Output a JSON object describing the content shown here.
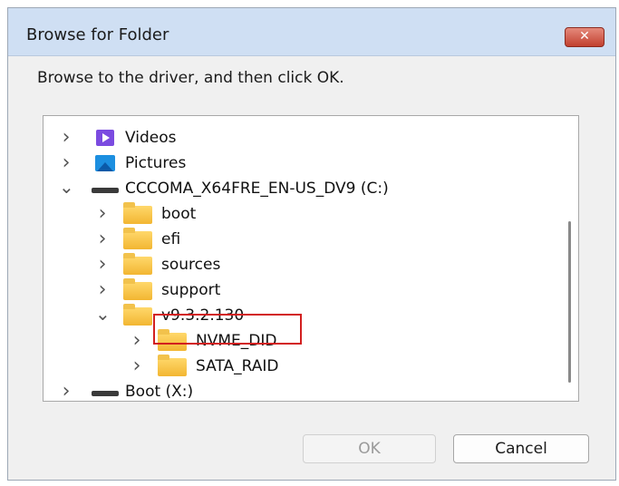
{
  "dialog": {
    "title": "Browse for Folder",
    "close_glyph": "✕",
    "instruction": "Browse to the driver, and then click OK.",
    "ok_label": "OK",
    "cancel_label": "Cancel",
    "ok_enabled": false
  },
  "tree": {
    "items": [
      {
        "label": "Videos",
        "icon": "videos-folder-icon",
        "state": "collapsed"
      },
      {
        "label": "Pictures",
        "icon": "pictures-folder-icon",
        "state": "collapsed"
      },
      {
        "label": "CCCOMA_X64FRE_EN-US_DV9 (C:)",
        "icon": "drive-icon",
        "state": "expanded"
      },
      {
        "label": "boot",
        "icon": "folder-icon",
        "state": "collapsed"
      },
      {
        "label": "efi",
        "icon": "folder-icon",
        "state": "collapsed"
      },
      {
        "label": "sources",
        "icon": "folder-icon",
        "state": "collapsed"
      },
      {
        "label": "support",
        "icon": "folder-icon",
        "state": "collapsed"
      },
      {
        "label": "v9.3.2.130",
        "icon": "folder-icon",
        "state": "expanded"
      },
      {
        "label": "NVME_DID",
        "icon": "folder-icon",
        "state": "collapsed",
        "highlighted": true
      },
      {
        "label": "SATA_RAID",
        "icon": "folder-icon",
        "state": "collapsed"
      },
      {
        "label": "Boot (X:)",
        "icon": "drive-icon",
        "state": "collapsed"
      }
    ]
  },
  "colors": {
    "titlebar": "#cfdff3",
    "close_button": "#c2402f",
    "highlight_box": "#d21f1f",
    "folder": "#f2b632"
  }
}
